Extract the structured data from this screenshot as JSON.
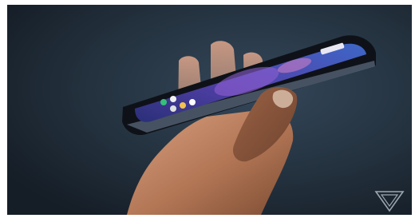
{
  "image": {
    "subject": "hand-holding-smartphone",
    "watermark": {
      "icon": "verge-logo-icon"
    }
  },
  "colors": {
    "background_dark": "#1e2a36",
    "background_mid": "#2c3b4a",
    "phone_frame": "#11151b",
    "screen_purple": "#4a3fa0",
    "screen_blue": "#2f4fa8",
    "skin_light": "#d9a584",
    "skin_dark": "#8e5a3d"
  }
}
